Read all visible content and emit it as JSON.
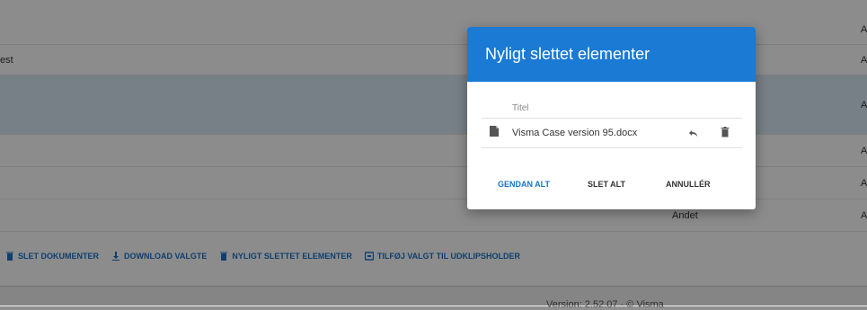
{
  "table": {
    "rows": [
      {
        "left": "",
        "right": "",
        "selected": false
      },
      {
        "left": "est",
        "right": "",
        "selected": false
      },
      {
        "left": "",
        "right": "",
        "selected": true
      },
      {
        "left": "",
        "right": "",
        "selected": false
      },
      {
        "left": "",
        "right": "",
        "selected": false
      },
      {
        "left": "",
        "right": "Andet",
        "selected": false
      }
    ]
  },
  "toolbar": {
    "delete_docs": "SLET DOKUMENTER",
    "download_selected": "DOWNLOAD VALGTE",
    "recently_deleted": "NYLIGT SLETTET ELEMENTER",
    "add_to_clipboard": "TILFØJ VALGT TIL UDKLIPSHOLDER"
  },
  "footer": {
    "version": "Version: 2.52.07 · © Visma"
  },
  "dialog": {
    "title": "Nyligt slettet elementer",
    "column_title": "Titel",
    "items": [
      {
        "name": "Visma Case version 95.docx"
      }
    ],
    "actions": {
      "restore_all": "GENDAN ALT",
      "delete_all": "SLET ALT",
      "cancel": "ANNULLÉR"
    }
  },
  "colors": {
    "accent": "#1a7ad4",
    "link": "#1a73c9",
    "selected_row": "#dbe9f6"
  }
}
